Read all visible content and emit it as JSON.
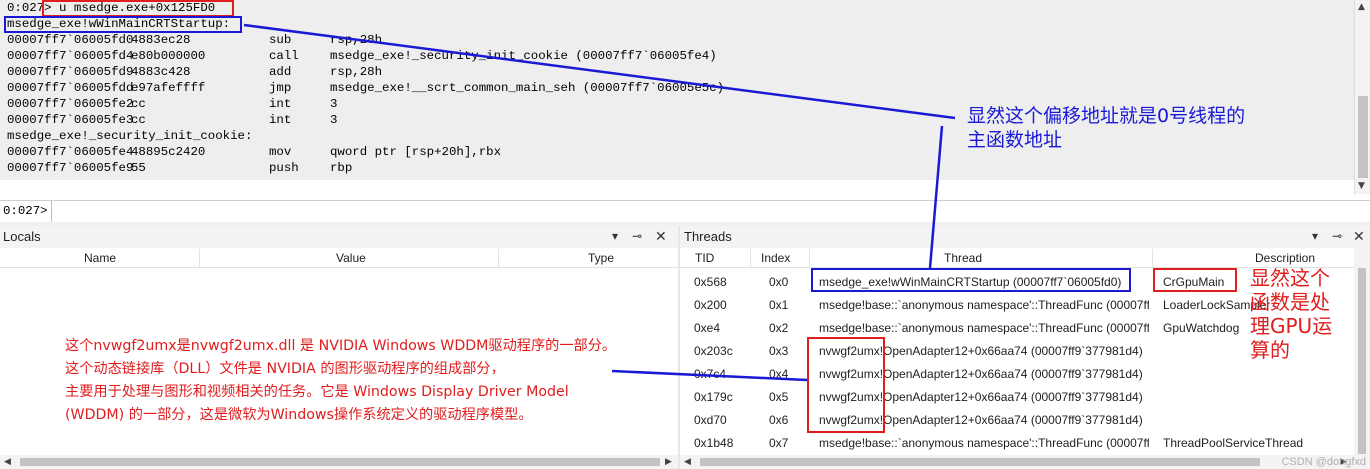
{
  "command": {
    "lines": [
      {
        "addr": "0:027> u msedge.exe+0x125FD0",
        "bytes": "",
        "op": "",
        "args": ""
      },
      {
        "addr": "msedge_exe!wWinMainCRTStartup:",
        "bytes": "",
        "op": "",
        "args": ""
      },
      {
        "addr": "00007ff7`06005fd0",
        "bytes": "4883ec28",
        "op": "sub",
        "args": "rsp,28h"
      },
      {
        "addr": "00007ff7`06005fd4",
        "bytes": "e80b000000",
        "op": "call",
        "args": "msedge_exe!_security_init_cookie (00007ff7`06005fe4)"
      },
      {
        "addr": "00007ff7`06005fd9",
        "bytes": "4883c428",
        "op": "add",
        "args": "rsp,28h"
      },
      {
        "addr": "00007ff7`06005fdd",
        "bytes": "e97afeffff",
        "op": "jmp",
        "args": "msedge_exe!__scrt_common_main_seh (00007ff7`06005e5c)"
      },
      {
        "addr": "00007ff7`06005fe2",
        "bytes": "cc",
        "op": "int",
        "args": "3"
      },
      {
        "addr": "00007ff7`06005fe3",
        "bytes": "cc",
        "op": "int",
        "args": "3"
      },
      {
        "addr": "msedge_exe!_security_init_cookie:",
        "bytes": "",
        "op": "",
        "args": ""
      },
      {
        "addr": "00007ff7`06005fe4",
        "bytes": "48895c2420",
        "op": "mov",
        "args": "qword ptr [rsp+20h],rbx"
      },
      {
        "addr": "00007ff7`06005fe9",
        "bytes": "55",
        "op": "push",
        "args": "rbp"
      }
    ],
    "prompt": "0:027>"
  },
  "locals": {
    "title": "Locals",
    "columns": [
      "Name",
      "Value",
      "Type"
    ]
  },
  "threads": {
    "title": "Threads",
    "columns": [
      "TID",
      "Index",
      "Thread",
      "Description"
    ],
    "rows": [
      {
        "tid": "0x568",
        "index": "0x0",
        "thread": "msedge_exe!wWinMainCRTStartup (00007ff7`06005fd0)",
        "desc": "CrGpuMain"
      },
      {
        "tid": "0x200",
        "index": "0x1",
        "thread": "msedge!base::`anonymous namespace'::ThreadFunc (00007ff…",
        "desc": "LoaderLockSampler"
      },
      {
        "tid": "0xe4",
        "index": "0x2",
        "thread": "msedge!base::`anonymous namespace'::ThreadFunc (00007ff…",
        "desc": "GpuWatchdog"
      },
      {
        "tid": "0x203c",
        "index": "0x3",
        "thread": "nvwgf2umx!OpenAdapter12+0x66aa74 (00007ff9`377981d4)",
        "desc": ""
      },
      {
        "tid": "0x7c4",
        "index": "0x4",
        "thread": "nvwgf2umx!OpenAdapter12+0x66aa74 (00007ff9`377981d4)",
        "desc": ""
      },
      {
        "tid": "0x179c",
        "index": "0x5",
        "thread": "nvwgf2umx!OpenAdapter12+0x66aa74 (00007ff9`377981d4)",
        "desc": ""
      },
      {
        "tid": "0xd70",
        "index": "0x6",
        "thread": "nvwgf2umx!OpenAdapter12+0x66aa74 (00007ff9`377981d4)",
        "desc": ""
      },
      {
        "tid": "0x1b48",
        "index": "0x7",
        "thread": "msedge!base::`anonymous namespace'::ThreadFunc (00007ff…",
        "desc": "ThreadPoolServiceThread"
      }
    ]
  },
  "annotations": {
    "note1": [
      "显然这个偏移地址就是0号线程的",
      "主函数地址"
    ],
    "note2": [
      "显然这个",
      "函数是处",
      "理GPU运",
      "算的"
    ],
    "note3": [
      "这个nvwgf2umx是nvwgf2umx.dll 是 NVIDIA Windows WDDM驱动程序的一部分。",
      "这个动态链接库（DLL）文件是 NVIDIA 的图形驱动程序的组成部分，",
      "主要用于处理与图形和视频相关的任务。它是 Windows Display Driver Model",
      "(WDDM) 的一部分，这是微软为Windows操作系统定义的驱动程序模型。"
    ]
  },
  "watermark": "CSDN @dongfxd",
  "colors": {
    "annotation_red": "#e11d1d",
    "annotation_blue": "#1a1ad6"
  }
}
